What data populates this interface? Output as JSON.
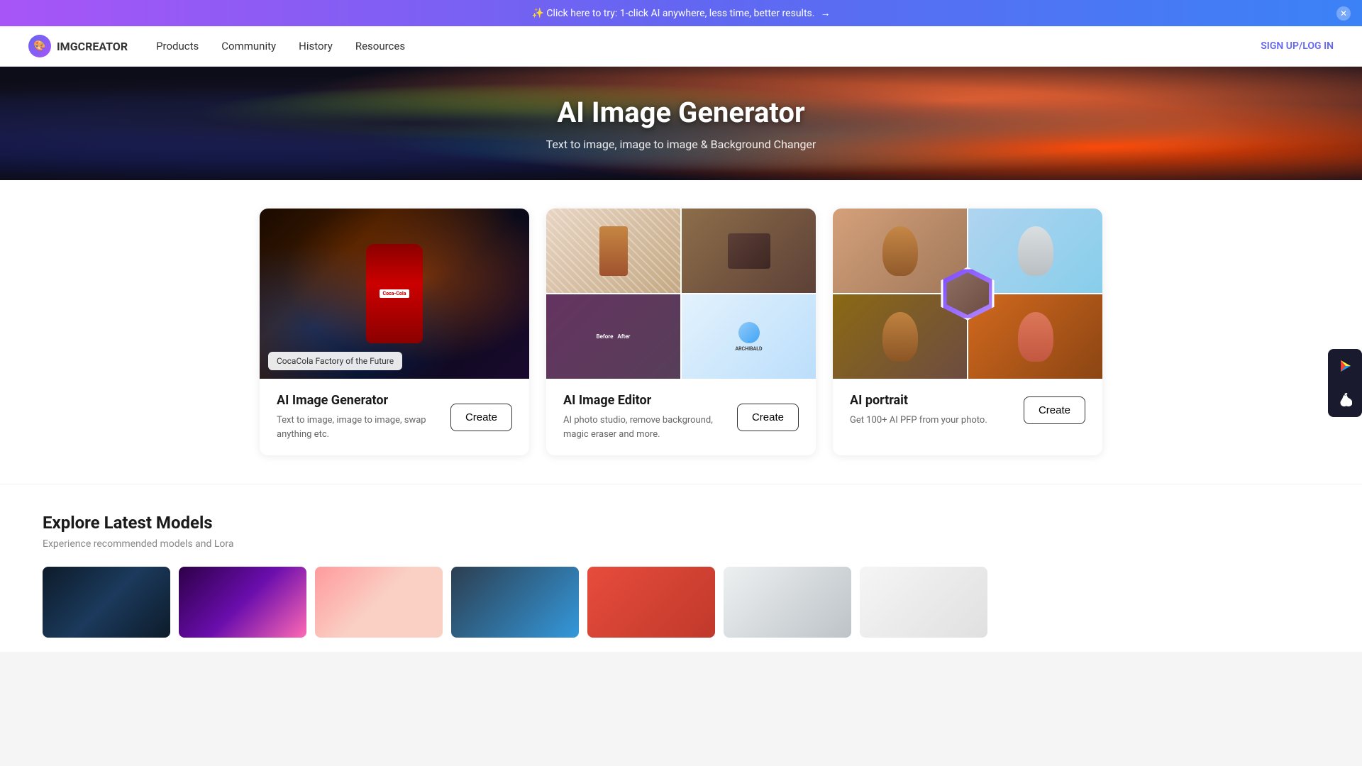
{
  "banner": {
    "text": "✨ Click here to try: 1-click AI anywhere, less time, better results.",
    "arrow": "→",
    "close": "✕"
  },
  "navbar": {
    "logo": "IMGCREATOR",
    "nav_items": [
      "Products",
      "Community",
      "History",
      "Resources"
    ],
    "signin": "SIGN UP/LOG IN"
  },
  "hero": {
    "title": "AI Image Generator",
    "subtitle": "Text to image, image to image & Background Changer"
  },
  "cards": [
    {
      "id": "card-generator",
      "title": "AI Image Generator",
      "description": "Text to image, image to image, swap anything etc.",
      "btn_label": "Create",
      "caption": "CocaCola Factory of the Future"
    },
    {
      "id": "card-editor",
      "title": "AI Image Editor",
      "description": "AI photo studio, remove background, magic eraser and more.",
      "btn_label": "Create"
    },
    {
      "id": "card-portrait",
      "title": "AI portrait",
      "description": "Get 100+ AI PFP from your photo.",
      "btn_label": "Create"
    }
  ],
  "explore": {
    "title": "Explore Latest Models",
    "subtitle": "Experience recommended models and Lora"
  },
  "appstore": {
    "google_icon": "▶",
    "apple_icon": ""
  }
}
